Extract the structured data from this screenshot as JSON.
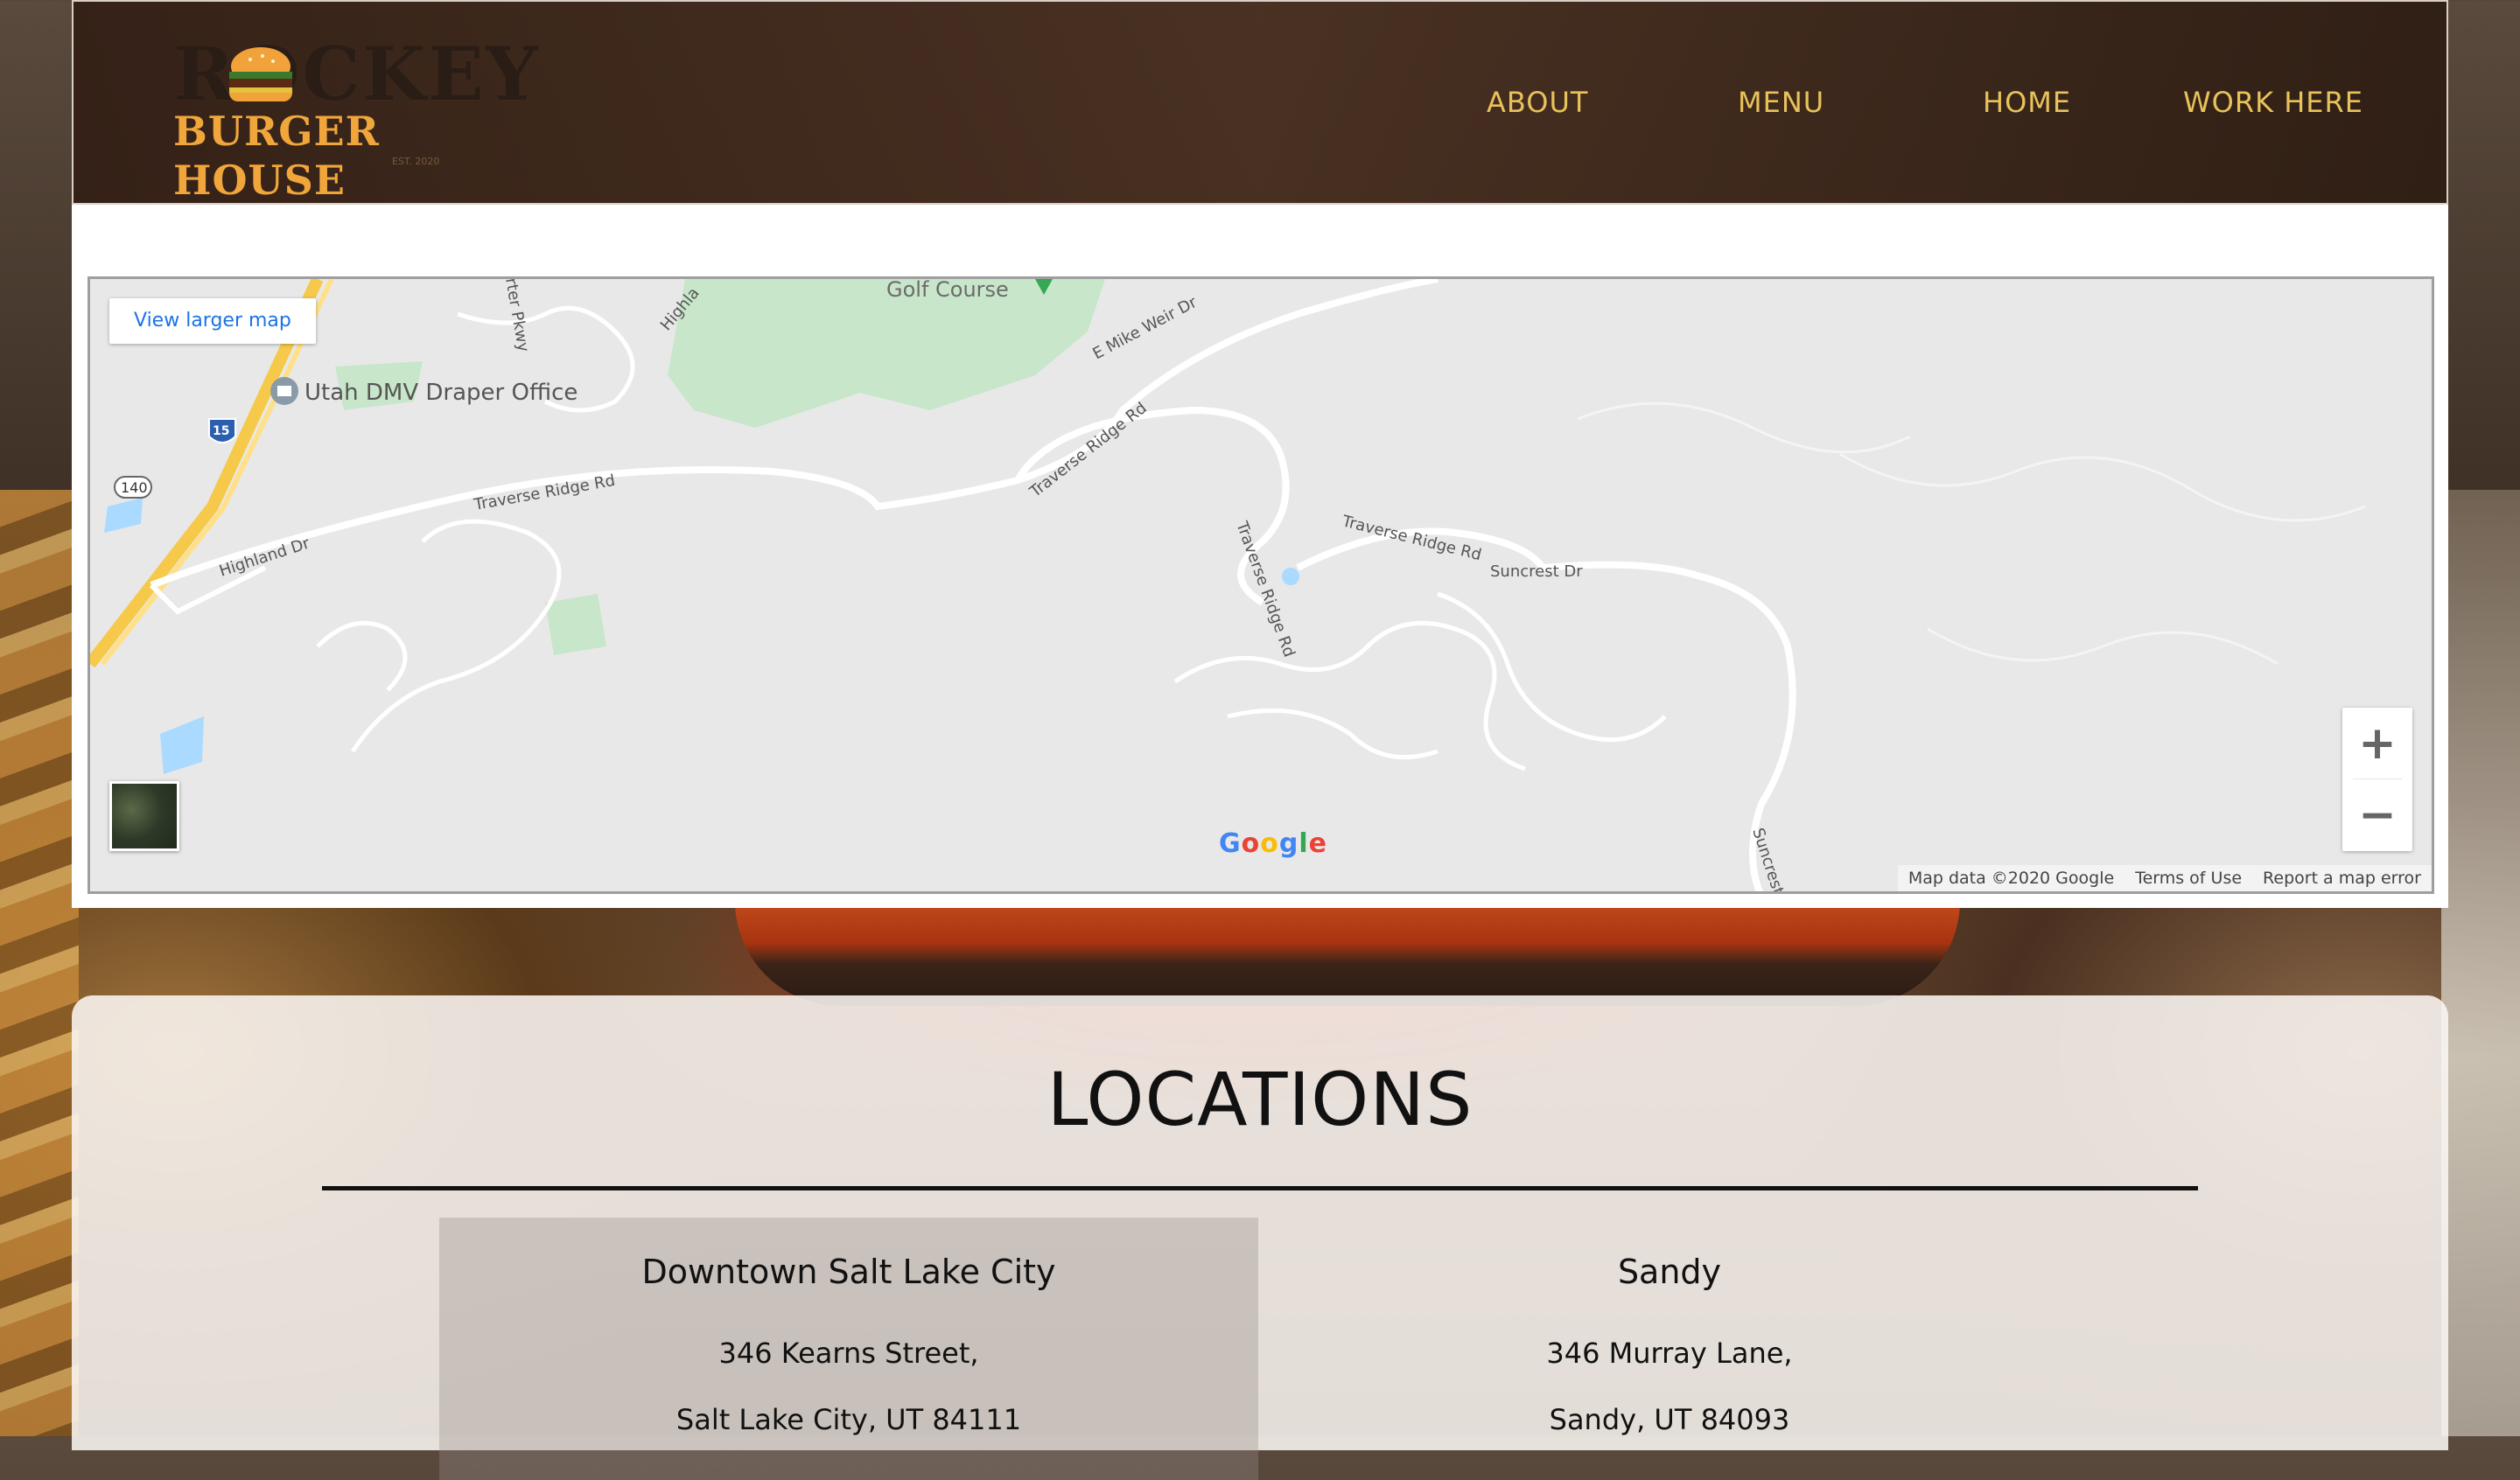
{
  "brand": {
    "logo_top": "ROCKEY",
    "logo_bottom": "BURGER HOUSE",
    "logo_est": "EST. 2020"
  },
  "nav": {
    "about": "ABOUT",
    "menu": "MENU",
    "home": "HOME",
    "work_here": "WORK HERE"
  },
  "map": {
    "view_larger": "View larger map",
    "zoom_in": "+",
    "zoom_out": "−",
    "google_logo_letters": [
      "G",
      "o",
      "o",
      "g",
      "l",
      "e"
    ],
    "google_colors": [
      "#4285F4",
      "#EA4335",
      "#FBBC05",
      "#4285F4",
      "#34A853",
      "#EA4335"
    ],
    "footer": {
      "attribution": "Map data ©2020 Google",
      "terms": "Terms of Use",
      "report": "Report a map error"
    },
    "labels": {
      "golf_course": "Golf Course",
      "mike_weir": "E Mike Weir Dr",
      "dmv": "Utah DMV Draper Office",
      "traverse1": "Traverse Ridge Rd",
      "traverse2": "Traverse Ridge Rd",
      "traverse3": "Traverse Ridge Rd",
      "traverse4": "Traverse Ridge Rd",
      "highland": "Highland Dr",
      "highland2": "Highla",
      "suncrest": "Suncrest Dr",
      "suncrest2": "Suncrest",
      "porter": "rter Pkwy",
      "i15": "15",
      "r140": "140"
    }
  },
  "locations": {
    "title": "LOCATIONS",
    "items": [
      {
        "name": "Downtown Salt Lake City",
        "line1": "346 Kearns Street,",
        "line2": "Salt Lake City, UT 84111"
      },
      {
        "name": "Sandy",
        "line1": "346 Murray Lane,",
        "line2": "Sandy, UT 84093"
      }
    ]
  },
  "colors": {
    "nav_text": "#e8c25a",
    "logo_orange": "#f0a63a",
    "map_link": "#1a73e8"
  }
}
